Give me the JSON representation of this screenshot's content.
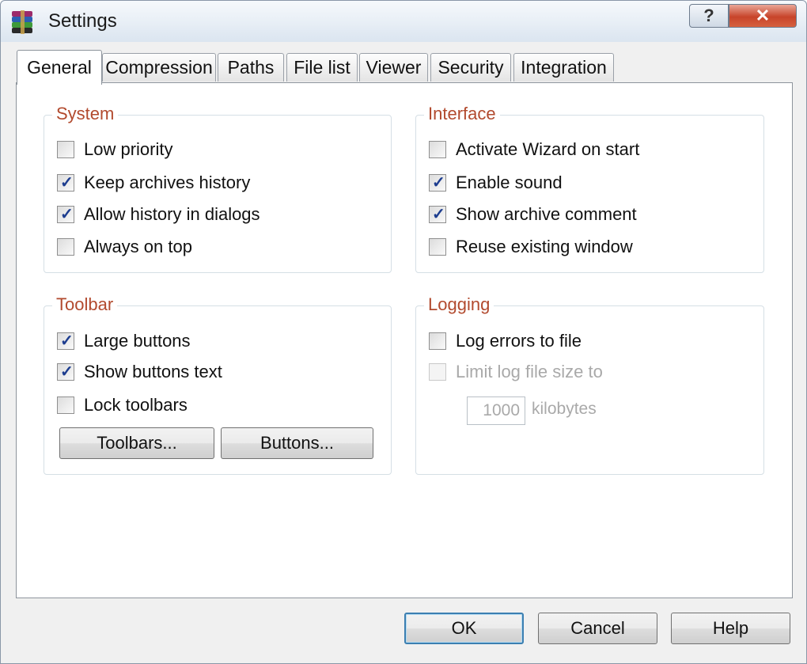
{
  "window": {
    "title": "Settings",
    "help_glyph": "?",
    "close_glyph": "✕",
    "accent_color": "#b24a2e"
  },
  "tabs": [
    {
      "label": "General",
      "active": true
    },
    {
      "label": "Compression"
    },
    {
      "label": "Paths"
    },
    {
      "label": "File list"
    },
    {
      "label": "Viewer"
    },
    {
      "label": "Security"
    },
    {
      "label": "Integration"
    }
  ],
  "system": {
    "title": "System",
    "items": [
      {
        "label": "Low priority",
        "checked": false
      },
      {
        "label": "Keep archives history",
        "checked": true
      },
      {
        "label": "Allow history in dialogs",
        "checked": true
      },
      {
        "label": "Always on top",
        "checked": false
      }
    ]
  },
  "interface": {
    "title": "Interface",
    "items": [
      {
        "label": "Activate Wizard on start",
        "checked": false
      },
      {
        "label": "Enable sound",
        "checked": true
      },
      {
        "label": "Show archive comment",
        "checked": true
      },
      {
        "label": "Reuse existing window",
        "checked": false
      }
    ]
  },
  "toolbar": {
    "title": "Toolbar",
    "items": [
      {
        "label": "Large buttons",
        "checked": true
      },
      {
        "label": "Show buttons text",
        "checked": true
      },
      {
        "label": "Lock toolbars",
        "checked": false
      }
    ],
    "toolbars_button": "Toolbars...",
    "buttons_button": "Buttons..."
  },
  "logging": {
    "title": "Logging",
    "items": [
      {
        "label": "Log errors to file",
        "checked": false
      },
      {
        "label": "Limit log file size to",
        "checked": false,
        "disabled": true
      }
    ],
    "size_value": "1000",
    "size_unit": "kilobytes"
  },
  "footer": {
    "ok": "OK",
    "cancel": "Cancel",
    "help": "Help"
  }
}
